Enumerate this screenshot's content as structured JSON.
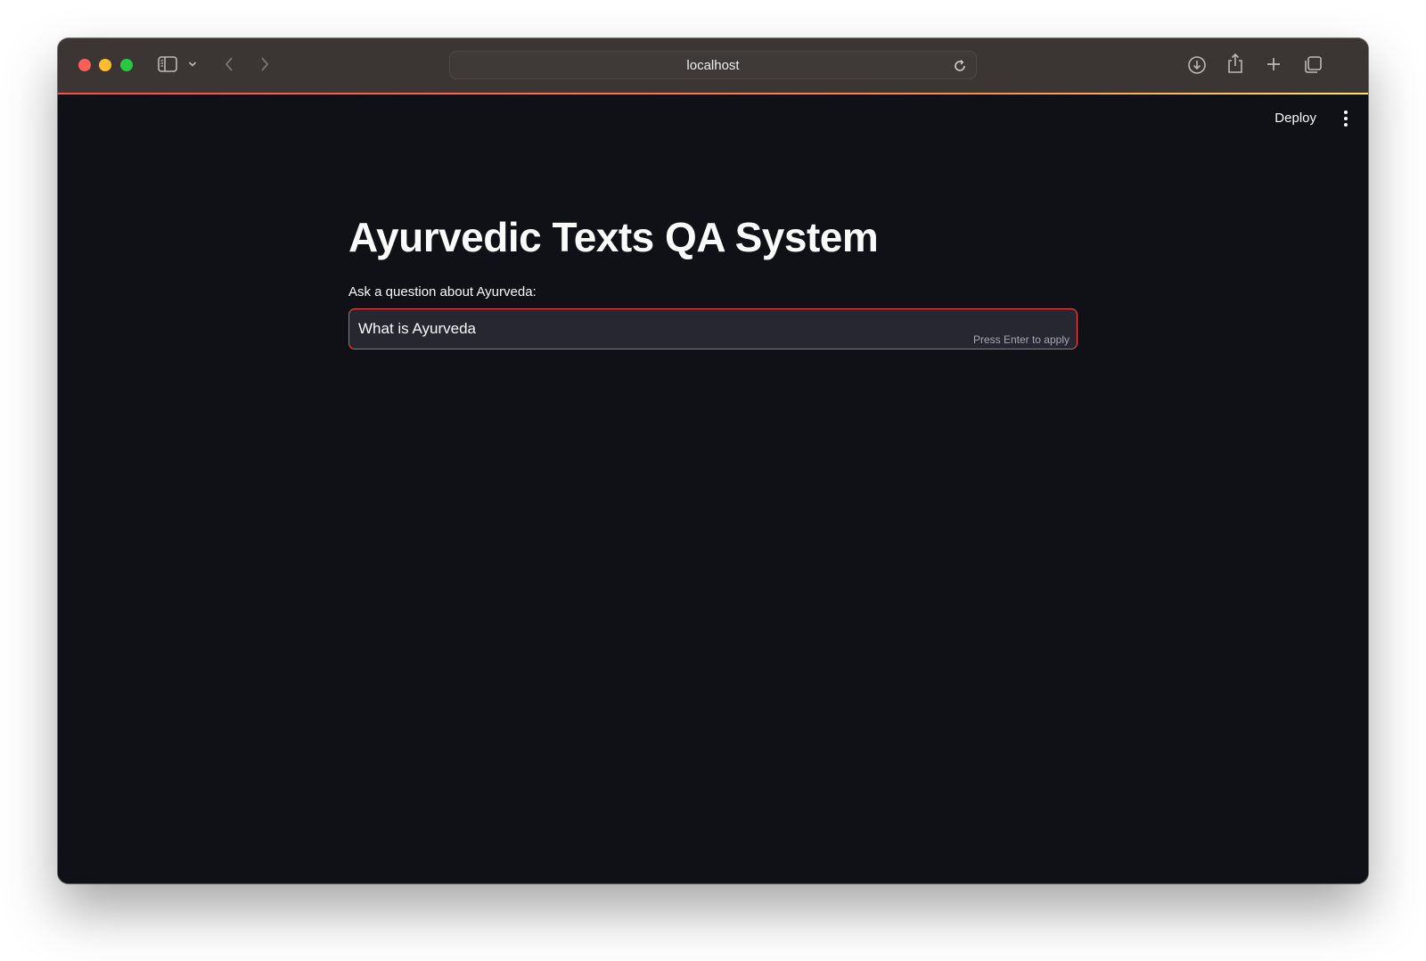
{
  "browser": {
    "url": "localhost",
    "icons": [
      "sidebar-icon",
      "chevron-down-icon",
      "back-icon",
      "forward-icon",
      "reload-icon",
      "download-icon",
      "share-icon",
      "new-tab-icon",
      "tabs-overview-icon"
    ]
  },
  "header": {
    "deploy_label": "Deploy",
    "menu_icon": "kebab-menu-icon"
  },
  "main": {
    "title": "Ayurvedic Texts QA System",
    "question_label": "Ask a question about Ayurveda:",
    "question_value": "What is Ayurveda",
    "input_hint": "Press Enter to apply"
  },
  "colors": {
    "background": "#0f1117",
    "titlebar": "#3b3634",
    "accent": "#ff4b4b",
    "input_bg": "#262730"
  }
}
